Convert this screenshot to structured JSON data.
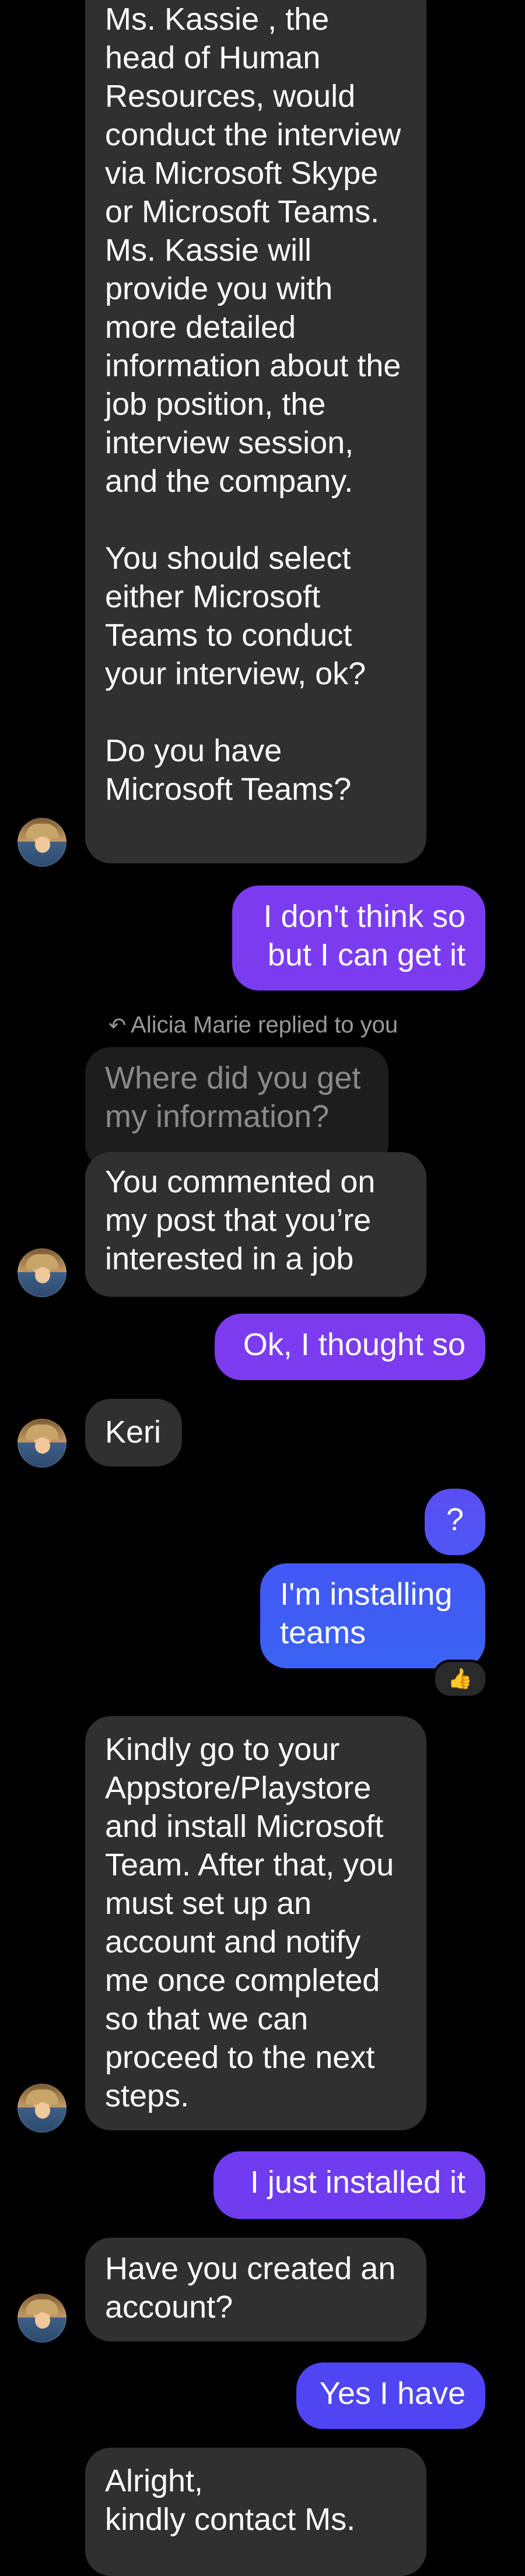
{
  "colors": {
    "background": "#000000",
    "incoming_bubble": "#303030",
    "quoted_bubble": "#1d1d1d",
    "outgoing_purple": "#7b3cf0",
    "outgoing_blue": "#3f5ff5",
    "muted_text": "#9a9a9a"
  },
  "messages": [
    {
      "id": "m1",
      "direction": "incoming",
      "text": "Ms. Kassie , the head of Human Resources, would conduct the interview via Microsoft Skype or Microsoft Teams. Ms. Kassie will provide you with more detailed information about the job position, the interview session, and the company.\n\nYou should select either Microsoft Teams to conduct your interview, ok?\n\nDo you have Microsoft Teams?"
    },
    {
      "id": "m2",
      "direction": "outgoing",
      "text": "I don't think so but I can get it"
    },
    {
      "id": "m3",
      "direction": "incoming",
      "reply_notice": "Alicia Marie replied to you",
      "quoted_text": "Where did you get my information?",
      "text": "You commented on my post that you’re interested in a job"
    },
    {
      "id": "m4",
      "direction": "outgoing",
      "text": "Ok, I thought so"
    },
    {
      "id": "m5",
      "direction": "incoming",
      "text": "Keri"
    },
    {
      "id": "m6",
      "direction": "outgoing",
      "text": "?"
    },
    {
      "id": "m7",
      "direction": "outgoing",
      "text": "I'm installing teams",
      "reaction": "👍"
    },
    {
      "id": "m8",
      "direction": "incoming",
      "text": "Kindly go to your Appstore/Playstore and install Microsoft Team. After that, you must set up an account and notify me once completed so that we can proceed to the next steps."
    },
    {
      "id": "m9",
      "direction": "outgoing",
      "text": "I just installed it"
    },
    {
      "id": "m10",
      "direction": "incoming",
      "text": "Have you created an account?"
    },
    {
      "id": "m11",
      "direction": "outgoing",
      "text": "Yes I have"
    },
    {
      "id": "m12",
      "direction": "incoming",
      "text": "Alright,\nkindly contact Ms."
    }
  ],
  "icons": {
    "reply": "reply-arrow-icon",
    "avatar": "contact-avatar"
  }
}
